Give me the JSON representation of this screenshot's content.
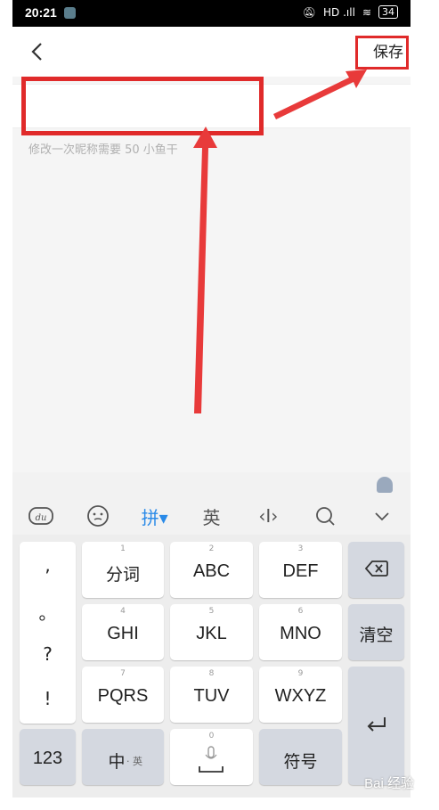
{
  "status_bar": {
    "time": "20:21",
    "signal": "HD .ıll",
    "wifi": "≋",
    "battery": "34"
  },
  "header": {
    "save_label": "保存"
  },
  "nickname": {
    "value": "",
    "hint": "修改一次昵称需要 50 小鱼干"
  },
  "keyboard": {
    "toolbar": [
      {
        "name": "du-logo",
        "glyph": "du"
      },
      {
        "name": "emoji",
        "glyph": "☺"
      },
      {
        "name": "pinyin",
        "glyph": "拼▾"
      },
      {
        "name": "english",
        "glyph": "英"
      },
      {
        "name": "cursor",
        "glyph": "‹I›"
      },
      {
        "name": "search",
        "glyph": "○"
      },
      {
        "name": "collapse",
        "glyph": "∨"
      }
    ],
    "punctuation": [
      ",",
      "。",
      "?",
      "!"
    ],
    "keys": [
      {
        "num": "1",
        "label": "分词"
      },
      {
        "num": "2",
        "label": "ABC"
      },
      {
        "num": "3",
        "label": "DEF"
      },
      {
        "num": "4",
        "label": "GHI"
      },
      {
        "num": "5",
        "label": "JKL"
      },
      {
        "num": "6",
        "label": "MNO"
      },
      {
        "num": "7",
        "label": "PQRS"
      },
      {
        "num": "8",
        "label": "TUV"
      },
      {
        "num": "9",
        "label": "WXYZ"
      }
    ],
    "clear_label": "清空",
    "num_label": "123",
    "lang_label": "中",
    "lang_sub": "· 英",
    "space_num": "0",
    "symbol_label": "符号"
  },
  "watermark": "Bai 经验"
}
